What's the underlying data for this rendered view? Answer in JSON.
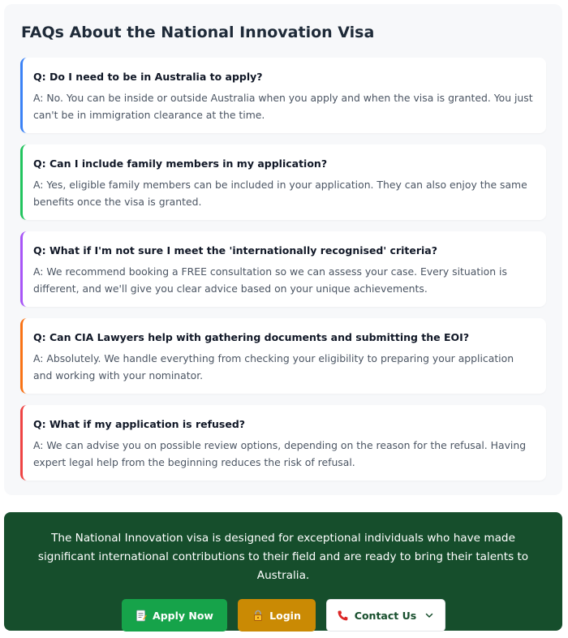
{
  "faq": {
    "title": "FAQs About the National Innovation Visa",
    "items": [
      {
        "question": "Q: Do I need to be in Australia to apply?",
        "answer": "A: No. You can be inside or outside Australia when you apply and when the visa is granted. You just can't be in immigration clearance at the time.",
        "accent": "#3b82f6"
      },
      {
        "question": "Q: Can I include family members in my application?",
        "answer": "A: Yes, eligible family members can be included in your application. They can also enjoy the same benefits once the visa is granted.",
        "accent": "#22c55e"
      },
      {
        "question": "Q: What if I'm not sure I meet the 'internationally recognised' criteria?",
        "answer": "A: We recommend booking a FREE consultation so we can assess your case. Every situation is different, and we'll give you clear advice based on your unique achievements.",
        "accent": "#a855f7"
      },
      {
        "question": "Q: Can CIA Lawyers help with gathering documents and submitting the EOI?",
        "answer": "A: Absolutely. We handle everything from checking your eligibility to preparing your application and working with your nominator.",
        "accent": "#f97316"
      },
      {
        "question": "Q: What if my application is refused?",
        "answer": "A: We can advise you on possible review options, depending on the reason for the refusal. Having expert legal help from the beginning reduces the risk of refusal.",
        "accent": "#ef4444"
      }
    ]
  },
  "cta": {
    "text": "The National Innovation visa is designed for exceptional individuals who have made significant international contributions to their field and are ready to bring their talents to Australia.",
    "apply_label": "Apply Now",
    "login_label": "Login",
    "contact_label": "Contact Us",
    "apply_icon": "memo-icon",
    "login_icon": "lock-icon",
    "contact_icon": "phone-icon",
    "background": "#164e2c"
  }
}
